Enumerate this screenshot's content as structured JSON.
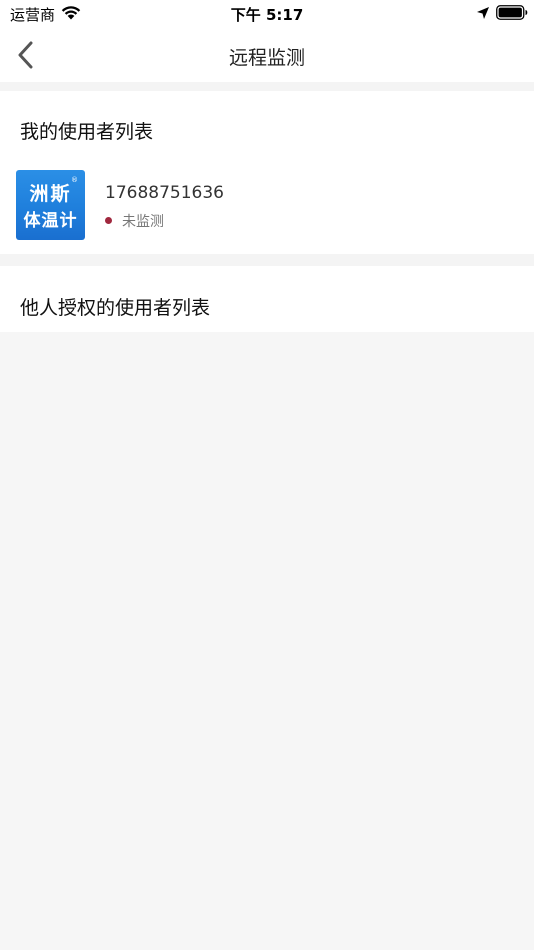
{
  "status_bar": {
    "carrier": "运营商",
    "time": "下午 5:17",
    "icons": [
      "wifi-icon",
      "location-arrow-icon",
      "battery-icon"
    ]
  },
  "nav": {
    "title": "远程监测",
    "back_icon": "chevron-left-icon"
  },
  "my_users": {
    "title": "我的使用者列表",
    "items": [
      {
        "avatar": {
          "line1": "洲斯",
          "line2": "体温计",
          "reg": "®"
        },
        "phone": "17688751636",
        "status": "未监测",
        "status_color": "#a0283e"
      }
    ]
  },
  "others_users": {
    "title": "他人授权的使用者列表"
  },
  "colors": {
    "background": "#f6f6f6",
    "card": "#ffffff",
    "avatar_blue": "#1f7fdc"
  }
}
